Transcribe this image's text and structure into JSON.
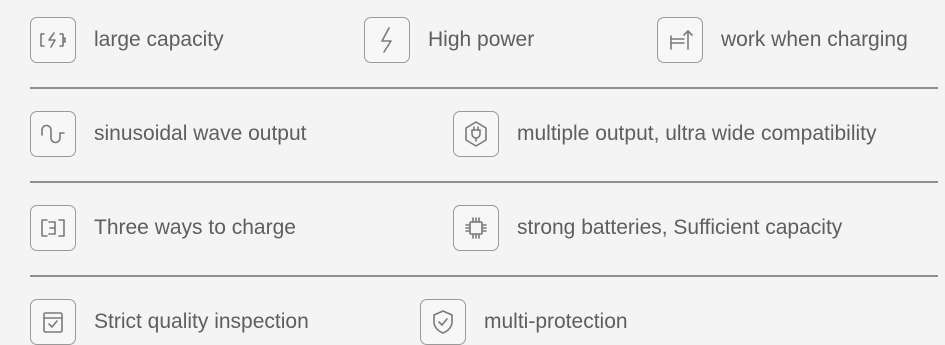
{
  "rows": [
    [
      {
        "label": "large capacity",
        "icon": "battery-charge-icon"
      },
      {
        "label": "High power",
        "icon": "lightning-icon"
      },
      {
        "label": "work when charging",
        "icon": "arrows-swap-icon"
      }
    ],
    [
      {
        "label": "sinusoidal wave output",
        "icon": "sine-wave-icon"
      },
      {
        "label": "multiple output, ultra wide compatibility",
        "icon": "hexagon-plug-icon"
      }
    ],
    [
      {
        "label": "Three ways to charge",
        "icon": "three-ways-icon"
      },
      {
        "label": "strong batteries, Sufficient capacity",
        "icon": "chip-icon"
      }
    ],
    [
      {
        "label": "Strict quality inspection",
        "icon": "checklist-icon"
      },
      {
        "label": "multi-protection",
        "icon": "shield-check-icon"
      }
    ]
  ]
}
